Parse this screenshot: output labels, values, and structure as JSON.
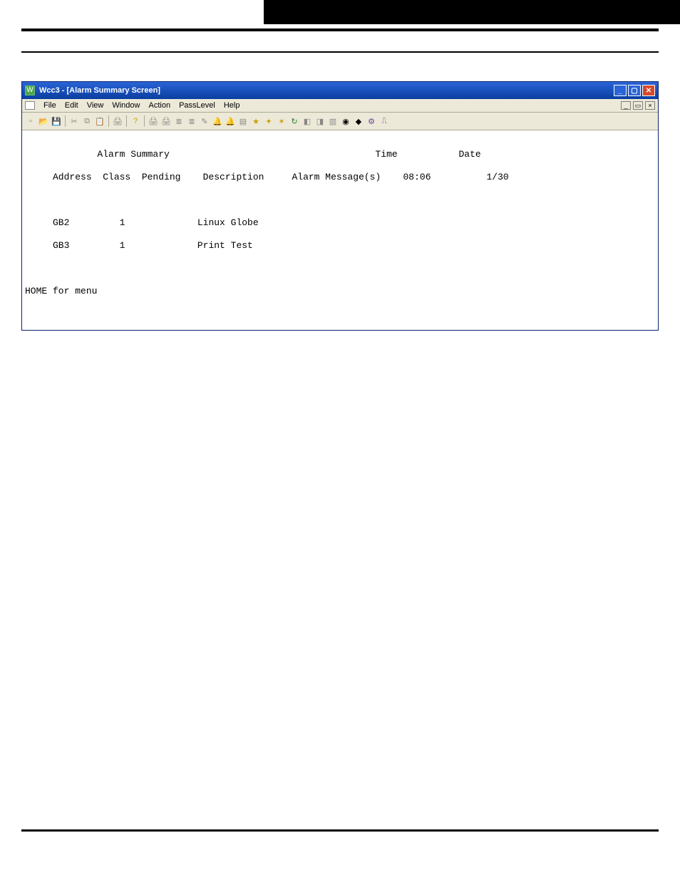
{
  "window": {
    "title": "Wcc3 - [Alarm Summary Screen]",
    "app_icon_letter": "W",
    "controls": {
      "min_label": "_",
      "max_label": "▢",
      "close_label": "✕"
    },
    "mdi_controls": {
      "min_label": "_",
      "max_label": "▭",
      "close_label": "×"
    }
  },
  "menu": {
    "items": [
      "File",
      "Edit",
      "View",
      "Window",
      "Action",
      "PassLevel",
      "Help"
    ]
  },
  "toolbar": {
    "icon_names": [
      "new-file-icon",
      "open-folder-icon",
      "save-icon",
      "sep",
      "cut-icon",
      "copy-icon",
      "paste-icon",
      "sep",
      "print-icon",
      "sep",
      "help-icon",
      "sep",
      "printer-a-icon",
      "printer-b-icon",
      "stack-a-icon",
      "stack-b-icon",
      "write-icon",
      "bell-a-icon",
      "bell-b-icon",
      "screen-icon",
      "wand-a-icon",
      "wand-b-icon",
      "star-icon",
      "refresh-icon",
      "tool-a-icon",
      "tool-b-icon",
      "page-icon",
      "camera-icon",
      "dot-icon",
      "knob-a-icon",
      "knob-b-icon"
    ],
    "icon_glyphs": {
      "new-file-icon": "▫",
      "open-folder-icon": "📂",
      "save-icon": "💾",
      "cut-icon": "✂",
      "copy-icon": "⧉",
      "paste-icon": "📋",
      "print-icon": "🖨",
      "help-icon": "?",
      "printer-a-icon": "🖨",
      "printer-b-icon": "🖨",
      "stack-a-icon": "≣",
      "stack-b-icon": "≣",
      "write-icon": "✎",
      "bell-a-icon": "🔔",
      "bell-b-icon": "🔔",
      "screen-icon": "▤",
      "wand-a-icon": "★",
      "wand-b-icon": "✦",
      "star-icon": "✶",
      "refresh-icon": "↻",
      "tool-a-icon": "◧",
      "tool-b-icon": "◨",
      "page-icon": "▥",
      "camera-icon": "◉",
      "dot-icon": "◆",
      "knob-a-icon": "⚙",
      "knob-b-icon": "⎍"
    }
  },
  "screen": {
    "heading_line": "             Alarm Summary                                     Time           Date",
    "columns_line": "     Address  Class  Pending    Description     Alarm Message(s)    08:06          1/30",
    "rows": [
      "     GB2         1             Linux Globe",
      "     GB3         1             Print Test"
    ],
    "footer_line": "HOME for menu"
  },
  "chart_data": {
    "type": "table",
    "title": "Alarm Summary",
    "time": "08:06",
    "date": "1/30",
    "columns": [
      "Address",
      "Class",
      "Pending",
      "Description",
      "Alarm Message(s)"
    ],
    "rows": [
      {
        "Address": "GB2",
        "Class": 1,
        "Pending": "",
        "Description": "Linux Globe",
        "Alarm Message(s)": ""
      },
      {
        "Address": "GB3",
        "Class": 1,
        "Pending": "",
        "Description": "Print Test",
        "Alarm Message(s)": ""
      }
    ],
    "footer_hint": "HOME for menu"
  }
}
